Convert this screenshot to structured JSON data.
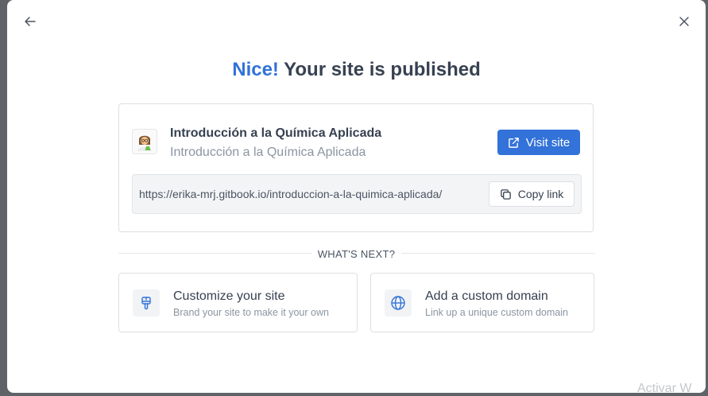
{
  "header": {
    "title_accent": "Nice!",
    "title_rest": " Your site is published"
  },
  "site": {
    "name": "Introducción a la Química Aplicada",
    "subtitle": "Introducción a la Química Aplicada",
    "url": "https://erika-mrj.gitbook.io/introduccion-a-la-quimica-aplicada/",
    "visit_label": "Visit site",
    "copy_label": "Copy link"
  },
  "next": {
    "label": "WHAT'S NEXT?",
    "items": [
      {
        "title": "Customize your site",
        "subtitle": "Brand your site to make it your own",
        "icon": "paintbrush-icon"
      },
      {
        "title": "Add a custom domain",
        "subtitle": "Link up a unique custom domain",
        "icon": "globe-icon"
      }
    ]
  },
  "watermark": "Activar W",
  "colors": {
    "accent": "#3272d9",
    "text": "#374151",
    "muted": "#8b95a1",
    "backdrop": "#5f6266"
  }
}
